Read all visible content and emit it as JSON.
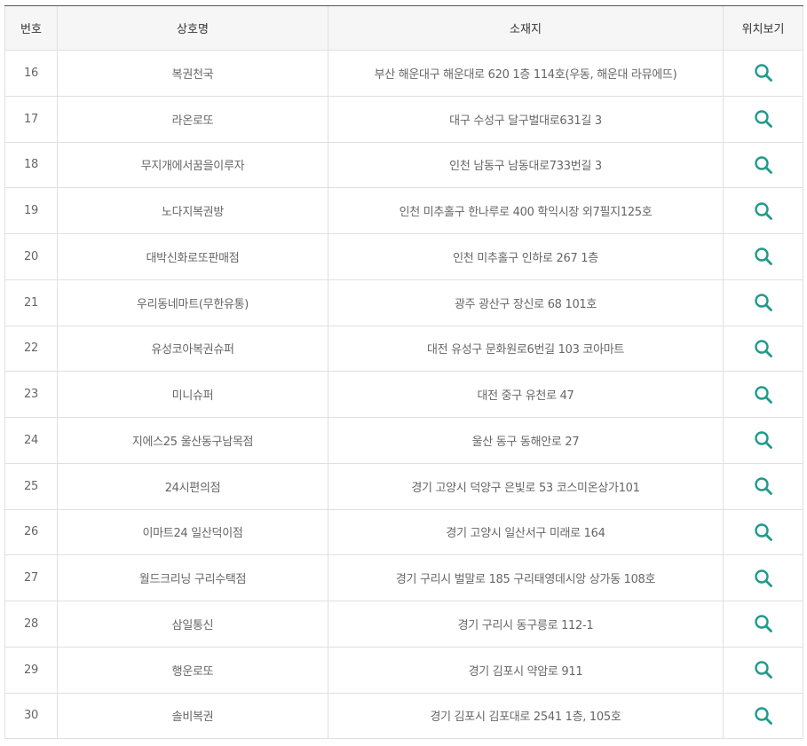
{
  "table": {
    "headers": {
      "no": "번호",
      "name": "상호명",
      "address": "소재지",
      "location": "위치보기"
    },
    "icon": "search-icon",
    "icon_color": "#1f9a8a",
    "rows": [
      {
        "no": "16",
        "name": "복권천국",
        "address": "부산 해운대구 해운대로 620 1층 114호(우동, 해운대 라뮤에뜨)"
      },
      {
        "no": "17",
        "name": "라온로또",
        "address": "대구 수성구 달구벌대로631길 3"
      },
      {
        "no": "18",
        "name": "무지개에서꿈을이루자",
        "address": "인천 남동구 남동대로733번길 3"
      },
      {
        "no": "19",
        "name": "노다지복권방",
        "address": "인천 미추홀구 한나루로 400 학익시장 외7필지125호"
      },
      {
        "no": "20",
        "name": "대박신화로또판매점",
        "address": "인천 미추홀구 인하로 267 1층"
      },
      {
        "no": "21",
        "name": "우리동네마트(무한유통)",
        "address": "광주 광산구 장신로 68 101호"
      },
      {
        "no": "22",
        "name": "유성코아복권슈퍼",
        "address": "대전 유성구 문화원로6번길 103 코아마트"
      },
      {
        "no": "23",
        "name": "미니슈퍼",
        "address": "대전 중구 유천로 47"
      },
      {
        "no": "24",
        "name": "지에스25 울산동구남목점",
        "address": "울산 동구 동해안로 27"
      },
      {
        "no": "25",
        "name": "24시편의점",
        "address": "경기 고양시 덕양구 은빛로 53 코스미온상가101"
      },
      {
        "no": "26",
        "name": "이마트24 일산덕이점",
        "address": "경기 고양시 일산서구 미래로 164"
      },
      {
        "no": "27",
        "name": "월드크리닝 구리수택점",
        "address": "경기 구리시 벌말로 185 구리태영데시앙 상가동 108호"
      },
      {
        "no": "28",
        "name": "삼일통신",
        "address": "경기 구리시 동구릉로 112-1"
      },
      {
        "no": "29",
        "name": "행운로또",
        "address": "경기 김포시 약암로 911"
      },
      {
        "no": "30",
        "name": "솔비복권",
        "address": "경기 김포시 김포대로 2541 1층, 105호"
      }
    ]
  }
}
